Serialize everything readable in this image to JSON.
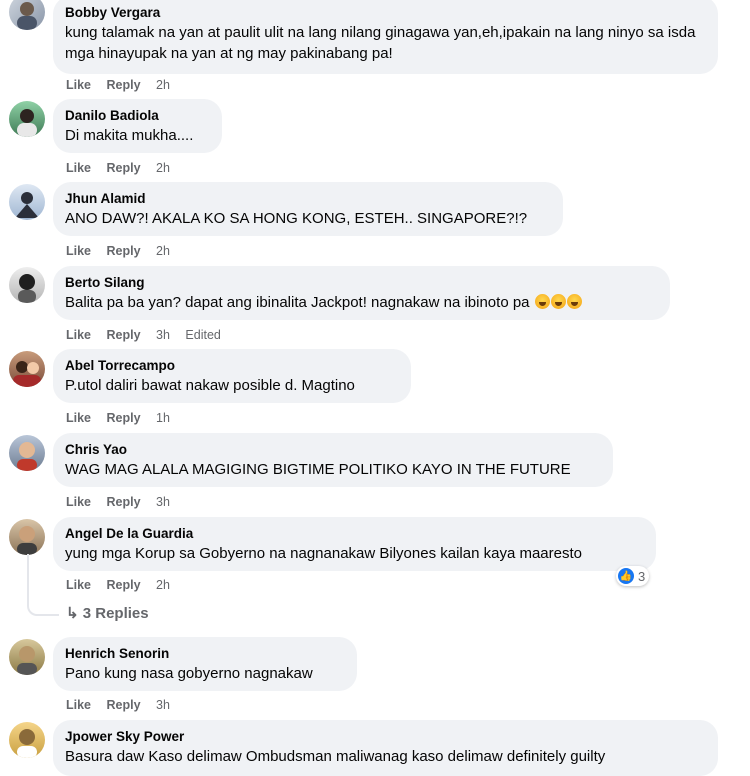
{
  "comments": [
    {
      "name": "Bobby Vergara",
      "text": "kung talamak na yan at paulit ulit na lang nilang ginagawa yan,eh,ipakain na lang ninyo sa isda mga hinayupak na yan at ng may pakinabang pa!",
      "like": "Like",
      "reply": "Reply",
      "time": "2h"
    },
    {
      "name": "Danilo Badiola",
      "text": "Di makita mukha....",
      "like": "Like",
      "reply": "Reply",
      "time": "2h"
    },
    {
      "name": "Jhun Alamid",
      "text": "ANO DAW?! AKALA KO SA HONG KONG, ESTEH.. SINGAPORE?!?",
      "like": "Like",
      "reply": "Reply",
      "time": "2h"
    },
    {
      "name": "Berto Silang",
      "text": "Balita pa ba yan? dapat ang ibinalita Jackpot! nagnakaw na ibinoto pa",
      "like": "Like",
      "reply": "Reply",
      "time": "3h",
      "edited": "Edited"
    },
    {
      "name": "Abel Torrecampo",
      "text": "P.utol daliri bawat nakaw posible d. Magtino",
      "like": "Like",
      "reply": "Reply",
      "time": "1h"
    },
    {
      "name": "Chris Yao",
      "text": "WAG MAG ALALA MAGIGING BIGTIME POLITIKO KAYO IN THE FUTURE",
      "like": "Like",
      "reply": "Reply",
      "time": "3h"
    },
    {
      "name": "Angel De la Guardia",
      "text": "yung mga Korup sa Gobyerno na nagnanakaw Bilyones kailan kaya maaresto",
      "like": "Like",
      "reply": "Reply",
      "time": "2h",
      "reaction_count": "3",
      "replies": "3 Replies"
    },
    {
      "name": "Henrich Senorin",
      "text": "Pano kung nasa gobyerno nagnakaw",
      "like": "Like",
      "reply": "Reply",
      "time": "3h"
    },
    {
      "name": "Jpower Sky Power",
      "text": "Basura daw Kaso delimaw Ombudsman maliwanag kaso delimaw definitely guilty"
    }
  ],
  "colors": {
    "bubble": "#f0f2f5",
    "meta": "#65676b",
    "like_blue": "#1877f2"
  },
  "icons": {
    "reaction": "like-icon",
    "replies": "reply-arrow-icon",
    "emoji": "rofl-emoji-icon"
  }
}
